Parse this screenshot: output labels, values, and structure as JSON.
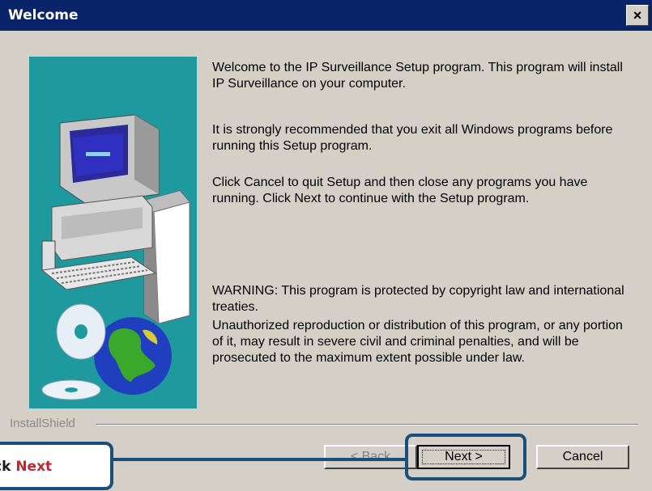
{
  "window": {
    "title": "Welcome",
    "close_label": "×"
  },
  "body": {
    "paragraphs": [
      "Welcome to the IP Surveillance Setup program.  This program will install IP Surveillance on your computer.",
      "It is strongly recommended that you exit all Windows programs before running this Setup program.",
      "Click Cancel to quit Setup and then close any programs you have running.  Click Next to continue with the Setup program.",
      "WARNING: This program is protected by copyright law and international treaties.",
      "Unauthorized reproduction or distribution of this program, or any portion of it, may result in severe civil and criminal penalties, and will be prosecuted to the maximum extent possible under law."
    ]
  },
  "footer": {
    "brand": "InstallShield",
    "back_label": "< Back",
    "next_label": "Next >",
    "cancel_label": "Cancel"
  },
  "callout": {
    "prefix": "ck ",
    "emphasis": "Next"
  },
  "colors": {
    "titlebar": "#0a246a",
    "dialog_bg": "#d4d0c8",
    "side_art_bg": "#1e9a9e",
    "highlight": "#1a4f7c",
    "callout_emphasis": "#c0262d"
  }
}
